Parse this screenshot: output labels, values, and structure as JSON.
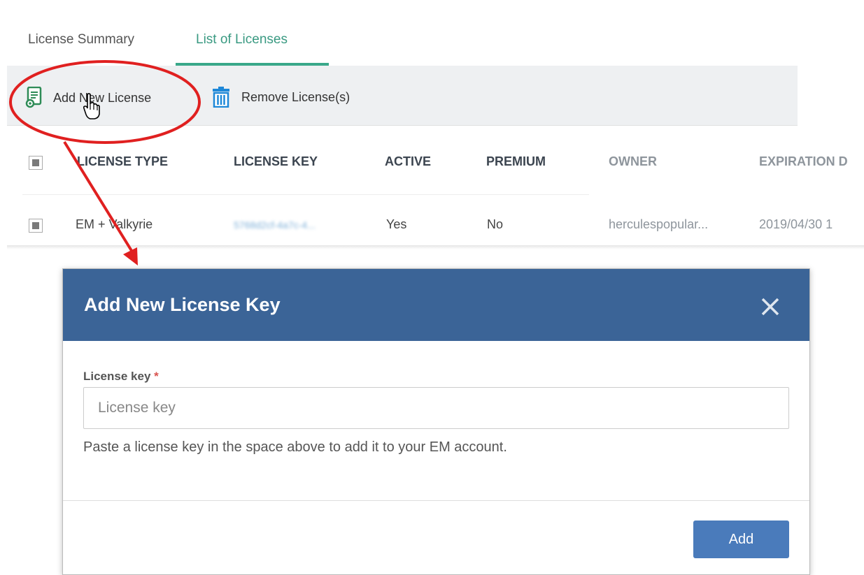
{
  "tabs": [
    {
      "label": "License Summary",
      "active": false
    },
    {
      "label": "List of Licenses",
      "active": true
    }
  ],
  "toolbar": {
    "add_label": "Add New License",
    "add_icon": "license-certificate-icon",
    "remove_label": "Remove License(s)",
    "remove_icon": "trash-icon"
  },
  "table": {
    "columns": [
      "LICENSE TYPE",
      "LICENSE KEY",
      "ACTIVE",
      "PREMIUM",
      "OWNER",
      "EXPIRATION D"
    ],
    "rows": [
      {
        "license_type": "EM + Valkyrie",
        "license_key": "5768d2cf-4a7c-4...",
        "active": "Yes",
        "premium": "No",
        "owner": "herculespopular...",
        "expiration": "2019/04/30 1"
      }
    ]
  },
  "modal": {
    "title": "Add New License Key",
    "field_label": "License key",
    "required_mark": "*",
    "input_placeholder": "License key",
    "input_value": "",
    "help_text": "Paste a license key in the space above to add it to your EM account.",
    "submit_label": "Add",
    "close_icon": "close-icon"
  },
  "colors": {
    "accent_green": "#3aa88a",
    "header_blue": "#3b6497",
    "button_blue": "#4a7bbb",
    "annotation_red": "#e02020"
  }
}
